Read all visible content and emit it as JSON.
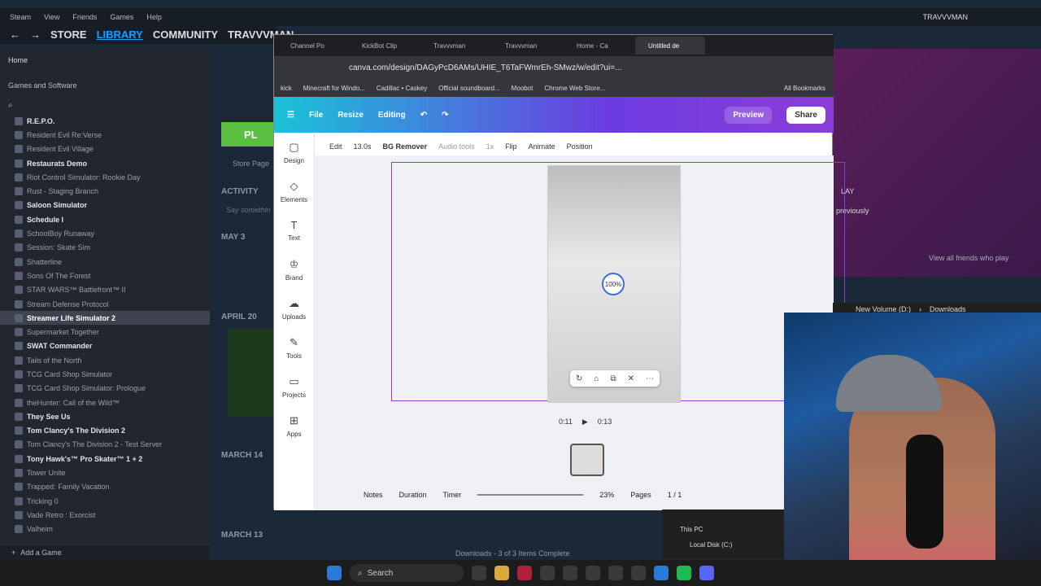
{
  "steam": {
    "menu": [
      "Steam",
      "View",
      "Friends",
      "Games",
      "Help"
    ],
    "nav": {
      "store": "STORE",
      "library": "LIBRARY",
      "community": "COMMUNITY",
      "user": "TRAVVVMAN"
    },
    "top_user": "TRAVVVMAN",
    "home": "Home",
    "filter": "Games and Software",
    "games": [
      {
        "name": "R.E.P.O.",
        "bold": true
      },
      {
        "name": "Resident Evil Re:Verse",
        "bold": false
      },
      {
        "name": "Resident Evil Village",
        "bold": false
      },
      {
        "name": "Restaurats Demo",
        "bold": true
      },
      {
        "name": "Riot Control Simulator: Rookie Day",
        "bold": false
      },
      {
        "name": "Rust - Staging Branch",
        "bold": false
      },
      {
        "name": "Saloon Simulator",
        "bold": true
      },
      {
        "name": "Schedule I",
        "bold": true
      },
      {
        "name": "SchoolBoy Runaway",
        "bold": false
      },
      {
        "name": "Session: Skate Sim",
        "bold": false
      },
      {
        "name": "Shatterline",
        "bold": false
      },
      {
        "name": "Sons Of The Forest",
        "bold": false
      },
      {
        "name": "STAR WARS™ Battlefront™ II",
        "bold": false
      },
      {
        "name": "Stream Defense Protocol",
        "bold": false
      },
      {
        "name": "Streamer Life Simulator 2",
        "bold": true,
        "selected": true
      },
      {
        "name": "Supermarket Together",
        "bold": false
      },
      {
        "name": "SWAT Commander",
        "bold": true
      },
      {
        "name": "Tails of the North",
        "bold": false
      },
      {
        "name": "TCG Card Shop Simulator",
        "bold": false
      },
      {
        "name": "TCG Card Shop Simulator: Prologue",
        "bold": false
      },
      {
        "name": "theHunter: Call of the Wild™",
        "bold": false
      },
      {
        "name": "They See Us",
        "bold": true
      },
      {
        "name": "Tom Clancy's The Division 2",
        "bold": true
      },
      {
        "name": "Tom Clancy's The Division 2 - Test Server",
        "bold": false
      },
      {
        "name": "Tony Hawk's™ Pro Skater™ 1 + 2",
        "bold": true
      },
      {
        "name": "Tower Unite",
        "bold": false
      },
      {
        "name": "Trapped: Family Vacation",
        "bold": false
      },
      {
        "name": "Tricking 0",
        "bold": false
      },
      {
        "name": "Vade Retro : Exorcist",
        "bold": false
      },
      {
        "name": "Valheim",
        "bold": false
      }
    ],
    "add_game": "Add a Game",
    "store_page": "Store Page",
    "activity": "ACTIVITY",
    "say_something": "Say somethin",
    "dates": [
      "MAY 3",
      "APRIL 20",
      "MARCH 14",
      "MARCH 13"
    ],
    "play_label": "PL",
    "friends_previously": "previously",
    "view_all_friends": "View all friends who play",
    "play_suffix": "LAY"
  },
  "chrome": {
    "tabs": [
      "Channel Po",
      "KickBot Clip",
      "Travvvman",
      "Travvvman",
      "Home - Ca",
      "Untitled de"
    ],
    "url": "canva.com/design/DAGyPcD6AMs/UHIE_T6TaFWmrEh-SMwz/w/edit?ui=...",
    "bookmarks": [
      "kick",
      "Minecraft for Windo...",
      "Cadillac • Caskey",
      "Official soundboard...",
      "Moobot",
      "Chrome Web Store...",
      "All Bookmarks"
    ]
  },
  "canva": {
    "top": {
      "file": "File",
      "resize": "Resize",
      "editing": "Editing",
      "preview": "Preview",
      "share": "Share"
    },
    "side": [
      {
        "label": "Design",
        "icon": "design-icon",
        "glyph": "▢"
      },
      {
        "label": "Elements",
        "icon": "elements-icon",
        "glyph": "◇"
      },
      {
        "label": "Text",
        "icon": "text-icon",
        "glyph": "T"
      },
      {
        "label": "Brand",
        "icon": "brand-icon",
        "glyph": "♔"
      },
      {
        "label": "Uploads",
        "icon": "uploads-icon",
        "glyph": "☁"
      },
      {
        "label": "Tools",
        "icon": "tools-icon",
        "glyph": "✎"
      },
      {
        "label": "Projects",
        "icon": "projects-icon",
        "glyph": "▭"
      },
      {
        "label": "Apps",
        "icon": "apps-icon",
        "glyph": "⊞"
      }
    ],
    "toolbar": {
      "edit": "Edit",
      "duration": "13.0s",
      "bg_remover": "BG Remover",
      "audio_tools": "Audio tools",
      "speed": "1x",
      "flip": "Flip",
      "animate": "Animate",
      "position": "Position"
    },
    "progress": "100%",
    "time_current": "0:11",
    "time_total": "0:13",
    "page_num": "1",
    "bottom": {
      "notes": "Notes",
      "duration": "Duration",
      "timer": "Timer",
      "zoom": "23%",
      "pages": "Pages",
      "page_count": "1 / 1"
    }
  },
  "explorer": {
    "path": [
      "New Volume (D:)",
      "Downloads"
    ],
    "this_pc": "This PC",
    "local_disk": "Local Disk (C:)",
    "status": "Downloads - 3 of 3 Items Complete"
  },
  "taskbar": {
    "search": "Search"
  }
}
